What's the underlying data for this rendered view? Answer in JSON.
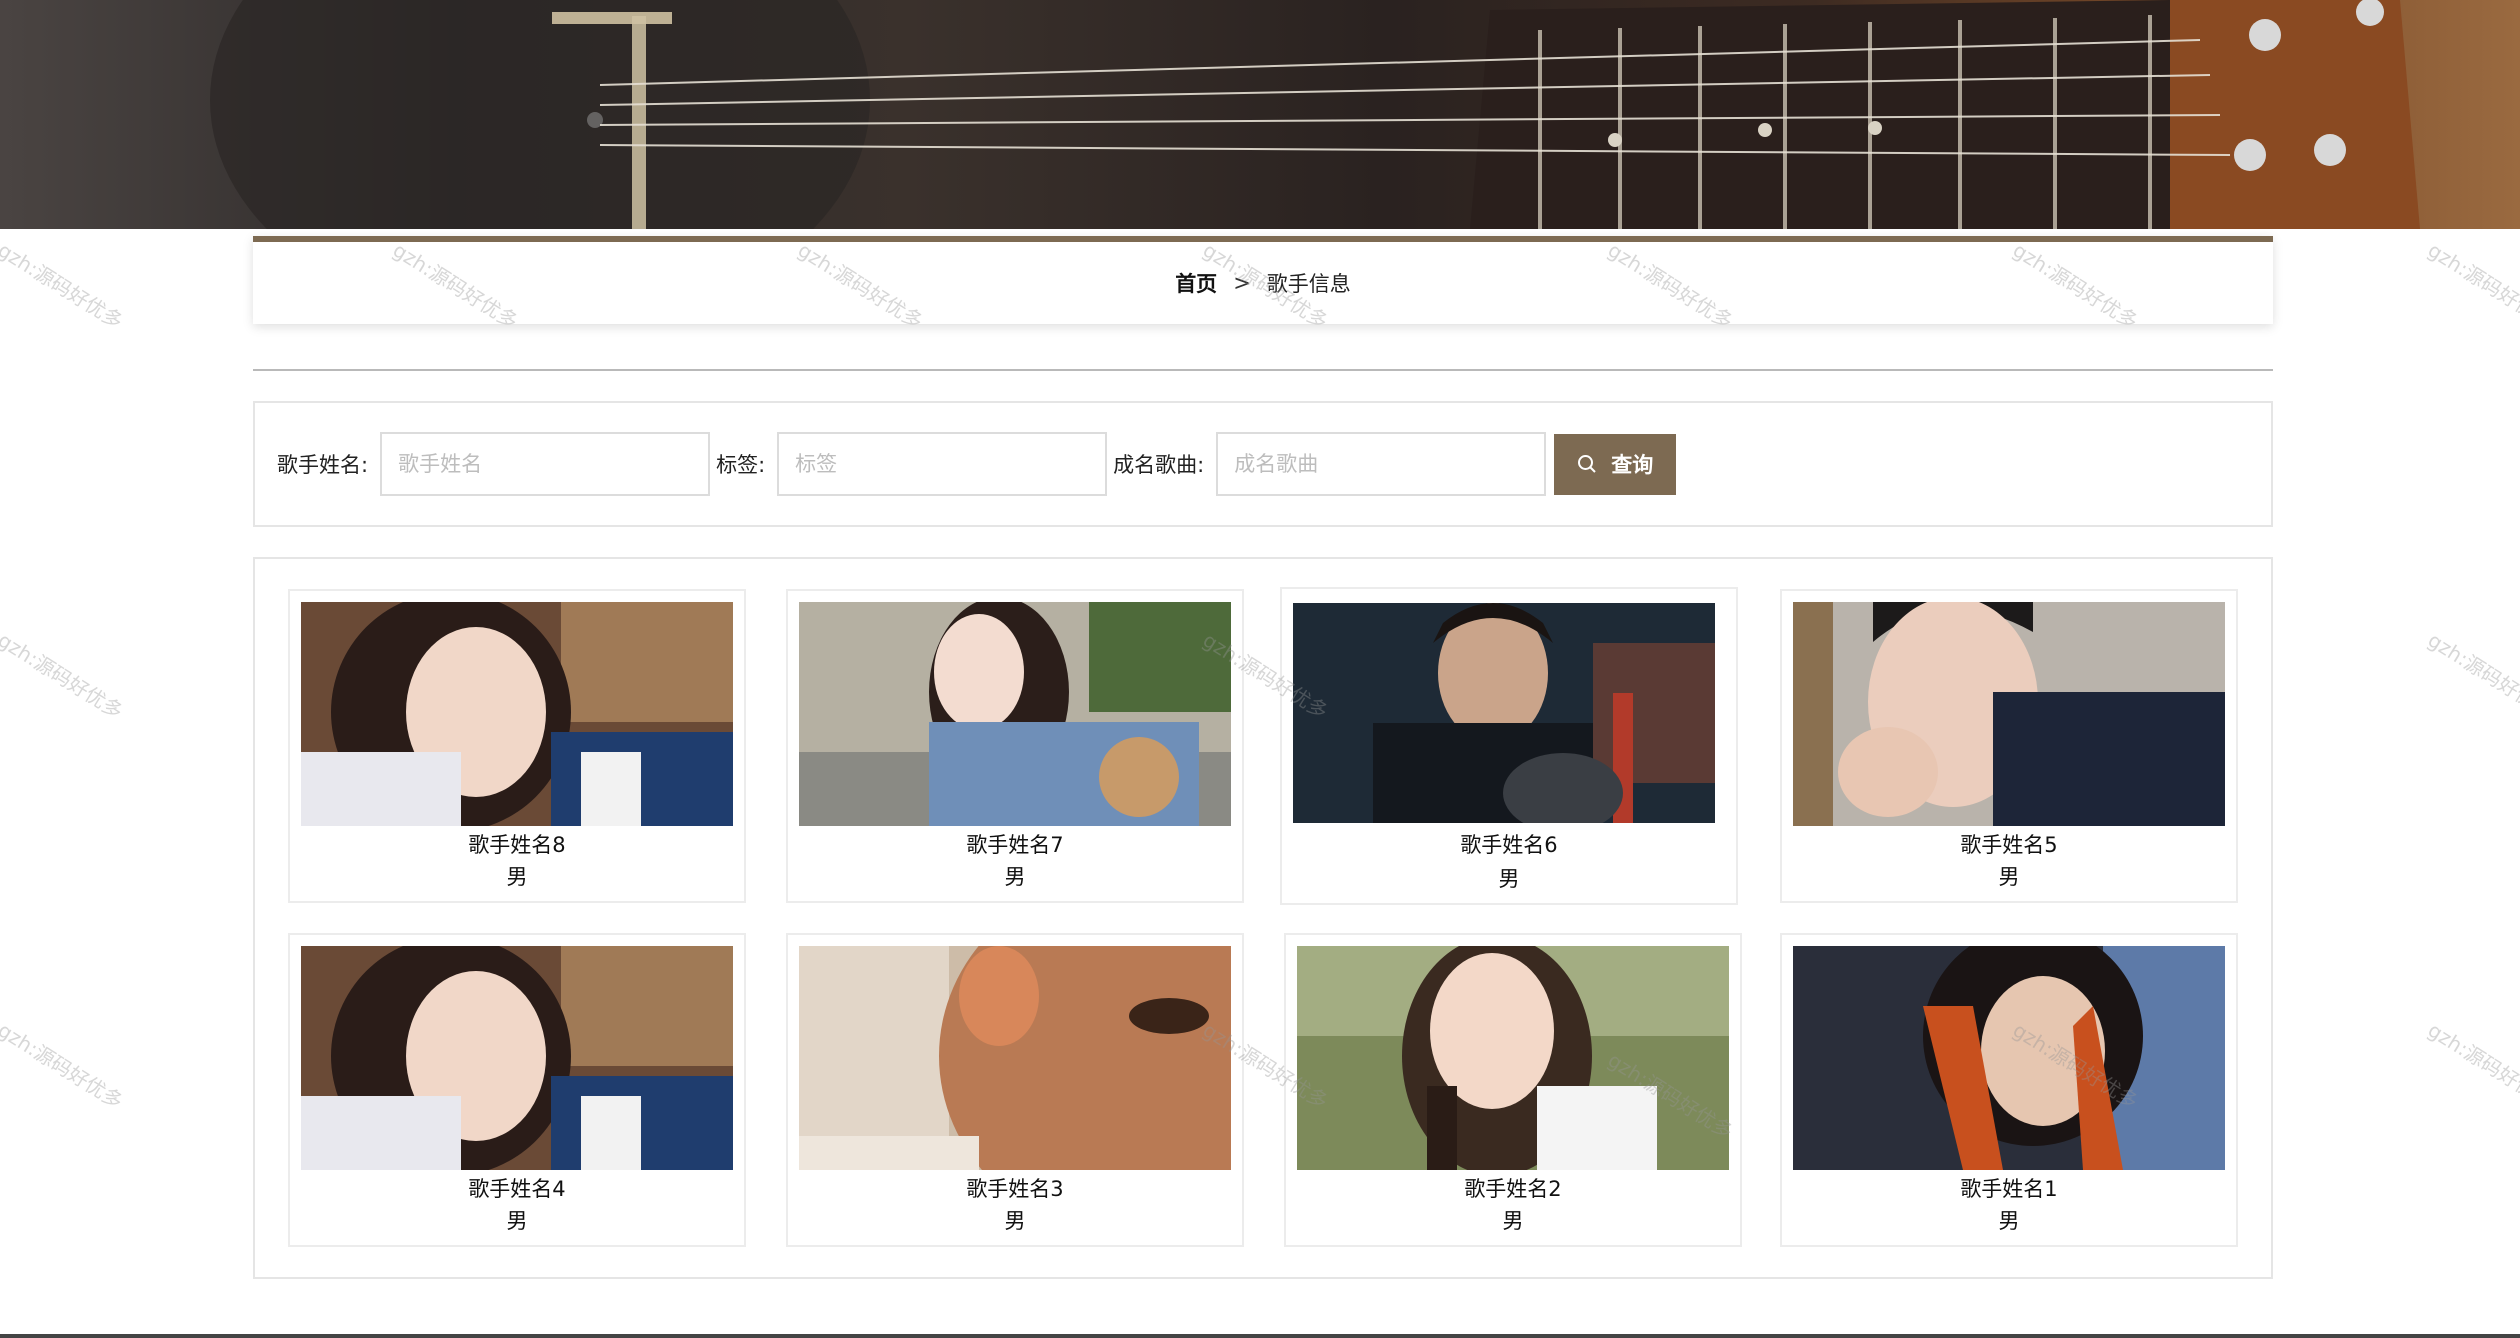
{
  "breadcrumb": {
    "home": "首页",
    "separator": ">",
    "current": "歌手信息"
  },
  "search": {
    "name_label": "歌手姓名:",
    "name_placeholder": "歌手姓名",
    "tag_label": "标签:",
    "tag_placeholder": "标签",
    "song_label": "成名歌曲:",
    "song_placeholder": "成名歌曲",
    "button_label": "查询",
    "button_icon": "search-icon"
  },
  "singers": [
    {
      "name": "歌手姓名8",
      "gender": "男"
    },
    {
      "name": "歌手姓名7",
      "gender": "男"
    },
    {
      "name": "歌手姓名6",
      "gender": "男"
    },
    {
      "name": "歌手姓名5",
      "gender": "男"
    },
    {
      "name": "歌手姓名4",
      "gender": "男"
    },
    {
      "name": "歌手姓名3",
      "gender": "男"
    },
    {
      "name": "歌手姓名2",
      "gender": "男"
    },
    {
      "name": "歌手姓名1",
      "gender": "男"
    }
  ],
  "watermark": "gzh:源码好优多",
  "colors": {
    "accent": "#7d6a52",
    "border": "#e5e5e5"
  }
}
